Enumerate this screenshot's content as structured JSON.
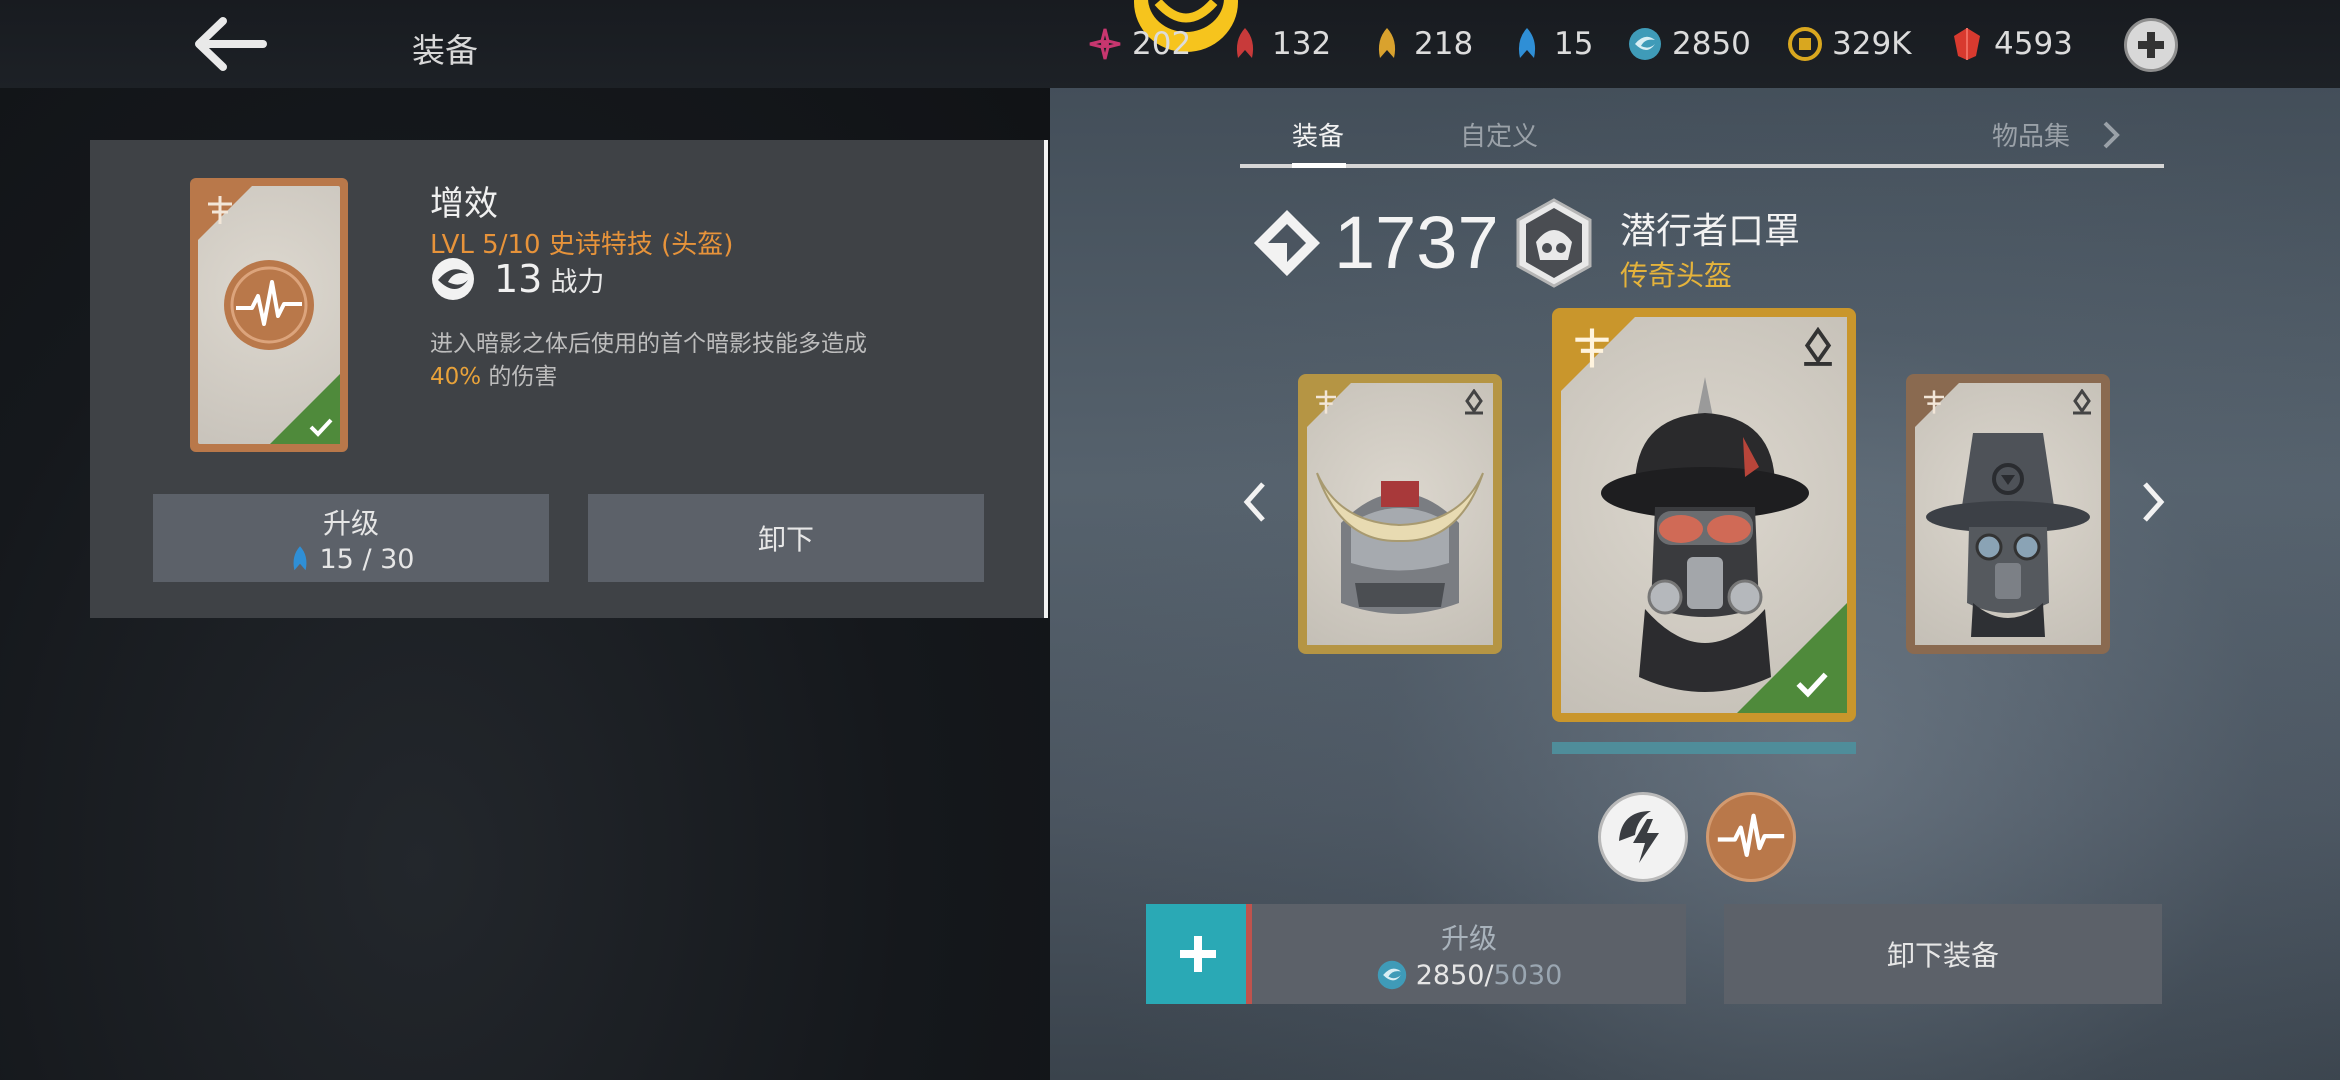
{
  "header": {
    "title": "装备",
    "currencies": [
      {
        "icon": "pink-star-icon",
        "value": "202",
        "color": "#c8366f"
      },
      {
        "icon": "red-feather-icon",
        "value": "132",
        "color": "#c83a3a"
      },
      {
        "icon": "gold-feather-icon",
        "value": "218",
        "color": "#d9a22e"
      },
      {
        "icon": "blue-feather-icon",
        "value": "15",
        "color": "#2f8fd6"
      },
      {
        "icon": "swirl-orb-icon",
        "value": "2850",
        "color": "#3f9bb8"
      },
      {
        "icon": "coin-icon",
        "value": "329K",
        "color": "#d9a71f"
      },
      {
        "icon": "ruby-icon",
        "value": "4593",
        "color": "#d83a2f"
      }
    ]
  },
  "detail": {
    "name": "增效",
    "level": "LVL  5/10  史诗特技 (头盔)",
    "power_value": "13",
    "power_label": "战力",
    "desc_line1": "进入暗影之体后使用的首个暗影技能多造成",
    "desc_pct": "40%",
    "desc_line2": " 的伤害",
    "upgrade_label": "升级",
    "upgrade_cost": "15 / 30",
    "unequip_label": "卸下"
  },
  "tabs": [
    {
      "label": "装备",
      "active": true
    },
    {
      "label": "自定义",
      "active": false
    },
    {
      "label": "物品集",
      "active": false
    }
  ],
  "item": {
    "score": "1737",
    "name": "潜行者口罩",
    "rarity": "传奇头盔"
  },
  "bottom": {
    "upgrade_label": "升级",
    "cost_have": "2850",
    "cost_sep": " / ",
    "cost_need": "5030",
    "unequip_label": "卸下装备"
  },
  "colors": {
    "epic": "#b9784a",
    "legendary": "#c9962c",
    "equipped": "#4f8a3b",
    "accent": "#2aa9b5"
  }
}
